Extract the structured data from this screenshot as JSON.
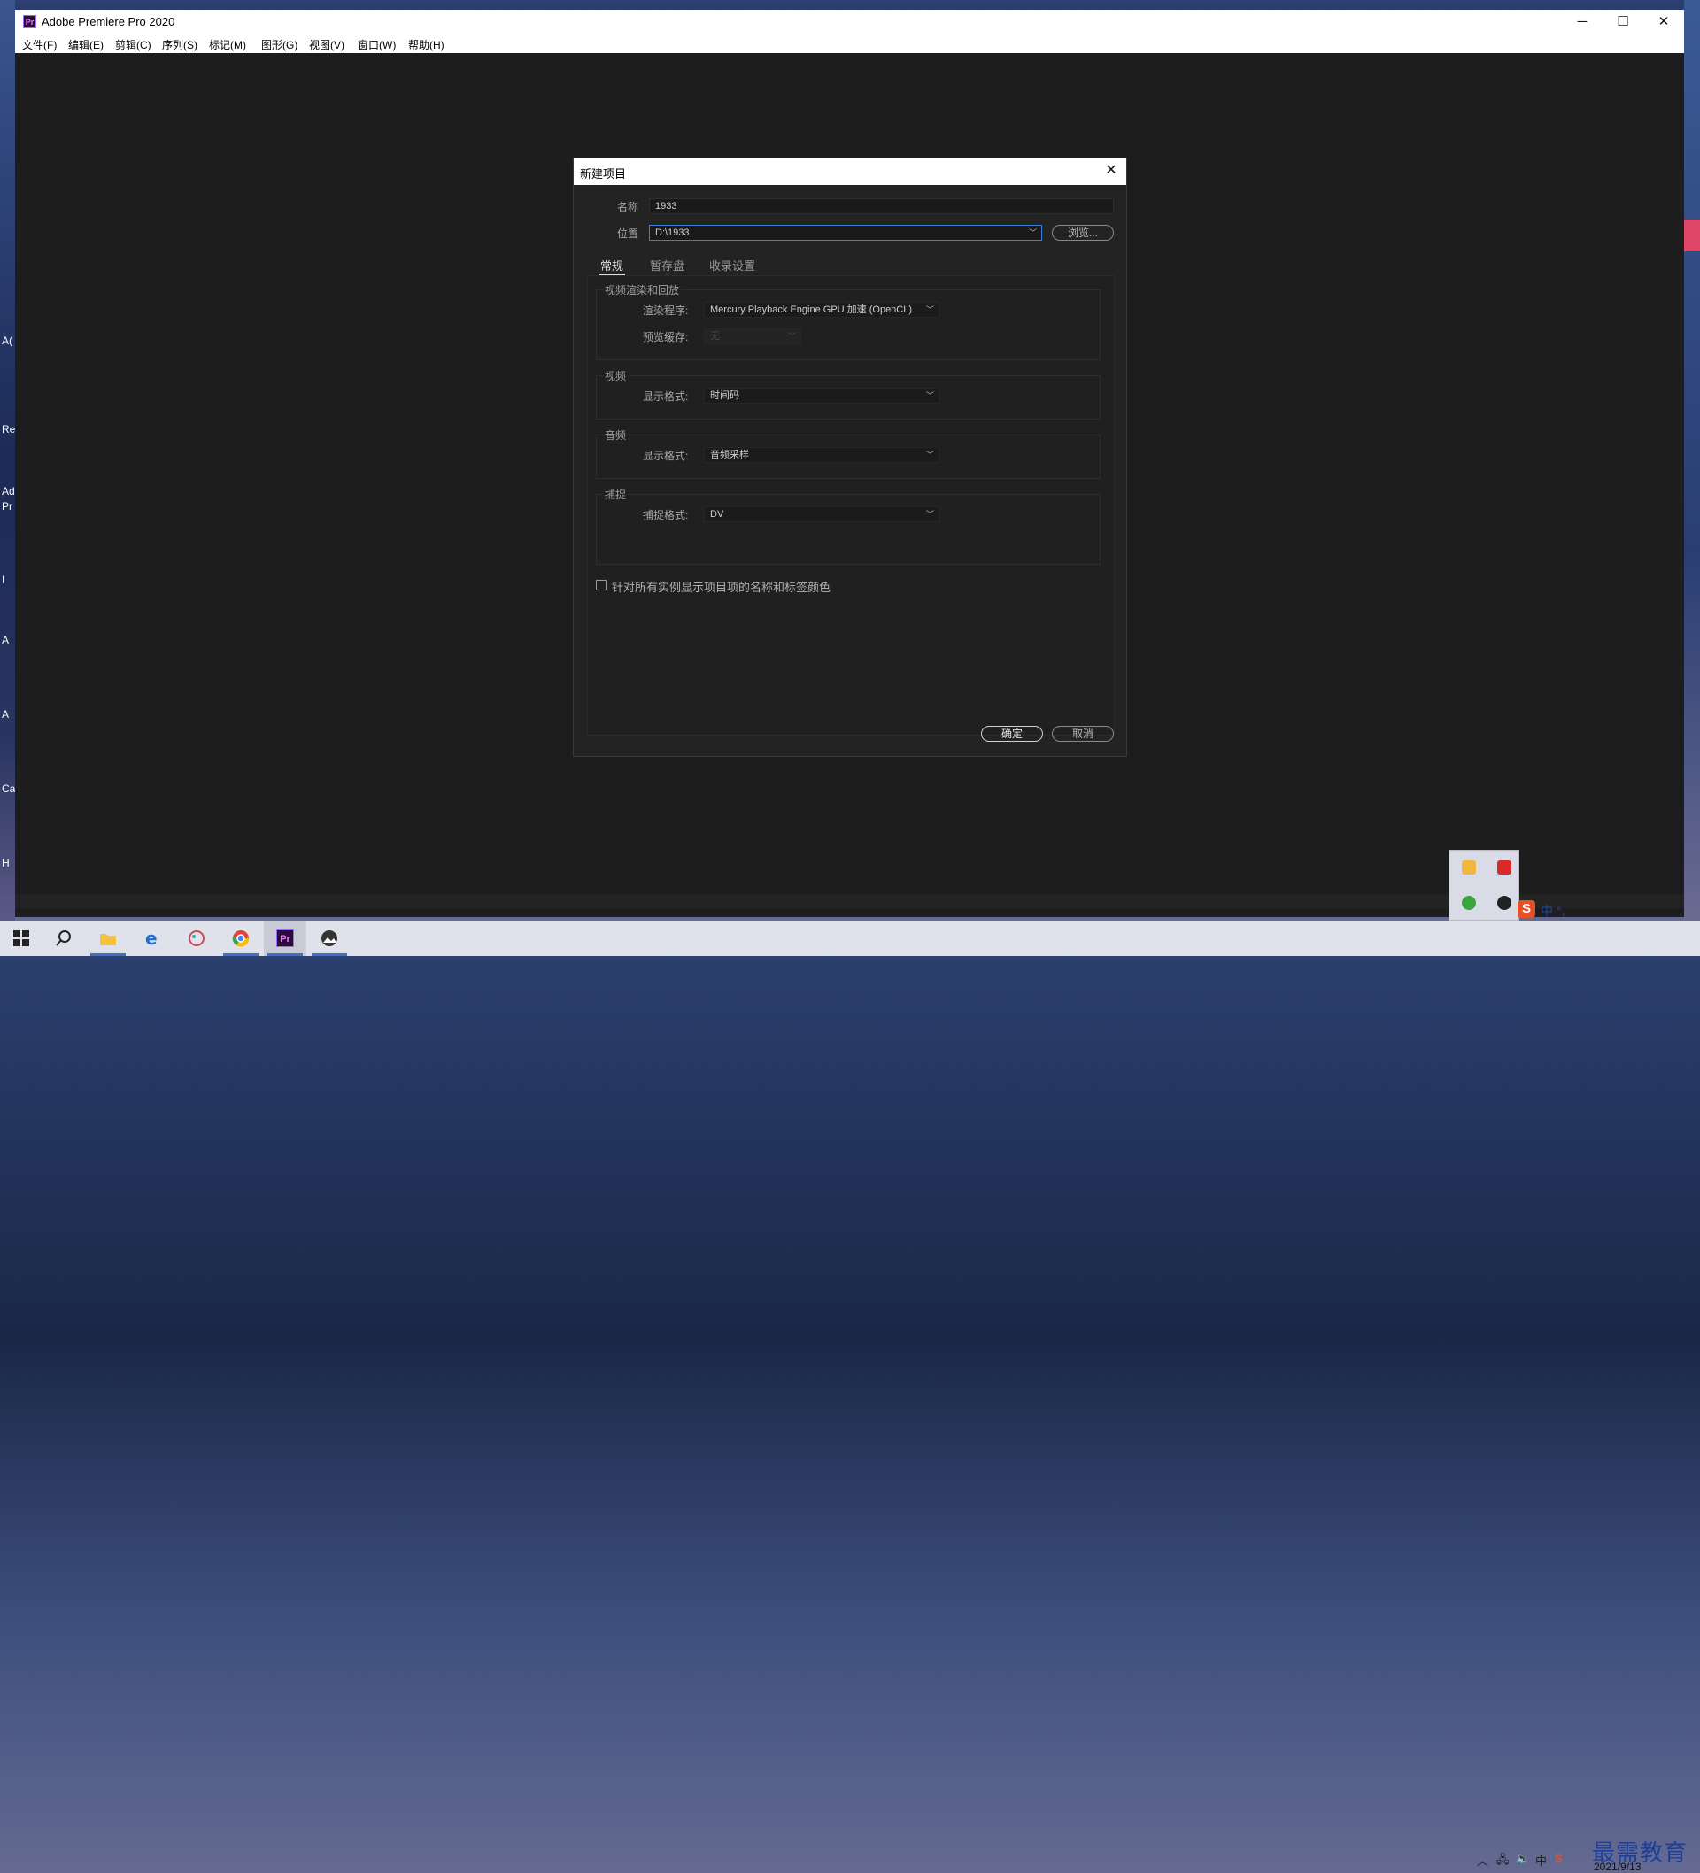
{
  "app": {
    "title": "Adobe Premiere Pro 2020",
    "icon_text": "Pr",
    "window_controls": {
      "minimize": "─",
      "maximize": "☐",
      "close": "✕"
    }
  },
  "menu": [
    "文件(F)",
    "编辑(E)",
    "剪辑(C)",
    "序列(S)",
    "标记(M)",
    "图形(G)",
    "视图(V)",
    "窗口(W)",
    "帮助(H)"
  ],
  "desktop_left_labels": [
    "A(",
    "Re",
    "Ad",
    "Pr",
    "I",
    "A",
    "A",
    "Ca",
    "H"
  ],
  "dialog": {
    "title": "新建项目",
    "close": "✕",
    "name_label": "名称",
    "name_value": "1933",
    "location_label": "位置",
    "location_value": "D:\\1933",
    "browse": "浏览...",
    "tabs": [
      "常规",
      "暂存盘",
      "收录设置"
    ],
    "active_tab": "常规",
    "groups": {
      "render": {
        "title": "视频渲染和回放",
        "renderer_label": "渲染程序:",
        "renderer_value": "Mercury Playback Engine GPU 加速 (OpenCL)",
        "preview_cache_label": "预览缓存:",
        "preview_cache_value": "无"
      },
      "video": {
        "title": "视频",
        "format_label": "显示格式:",
        "format_value": "时间码"
      },
      "audio": {
        "title": "音频",
        "format_label": "显示格式:",
        "format_value": "音频采样"
      },
      "capture": {
        "title": "捕捉",
        "format_label": "捕捉格式:",
        "format_value": "DV"
      }
    },
    "checkbox_label": "针对所有实例显示项目项的名称和标签颜色",
    "checkbox_checked": false,
    "ok": "确定",
    "cancel": "取消"
  },
  "taskbar": {
    "watermark": "最需教育",
    "date": "2021/9/13",
    "ime_text": "中 °,"
  }
}
